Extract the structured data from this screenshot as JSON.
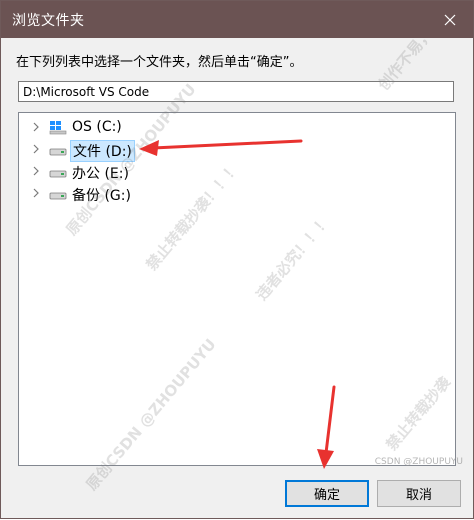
{
  "window": {
    "title": "浏览文件夹"
  },
  "instruction": "在下列列表中选择一个文件夹，然后单击“确定”。",
  "path_field": {
    "value": "D:\\Microsoft VS Code"
  },
  "tree": {
    "items": [
      {
        "label": "OS (C:)",
        "icon": "windows-drive-icon"
      },
      {
        "label": "文件 (D:)",
        "icon": "drive-icon",
        "selected": true
      },
      {
        "label": "办公 (E:)",
        "icon": "drive-icon"
      },
      {
        "label": "备份 (G:)",
        "icon": "drive-icon"
      }
    ]
  },
  "buttons": {
    "ok_label": "确定",
    "cancel_label": "取消"
  },
  "watermarks": {
    "texts": [
      "创作不易，",
      "原创CSDN @ZHOUPUYU",
      "禁止转载抄袭！！！",
      "违者必究！！！",
      "原创CSDN @ZHOUPUYU",
      "禁止转载抄袭"
    ],
    "corner": "CSDN @ZHOUPUYU"
  },
  "colors": {
    "titlebar": "#6b5353",
    "selection": "#cce8ff",
    "accent": "#0078d7",
    "arrow": "#e8322f"
  }
}
